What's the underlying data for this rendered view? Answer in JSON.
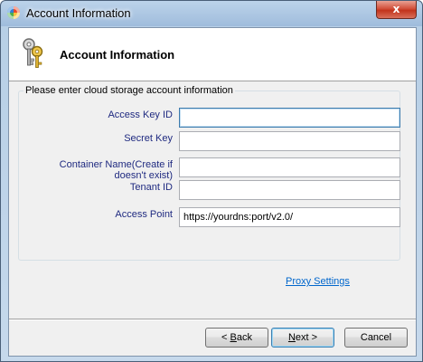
{
  "window": {
    "title": "Account Information",
    "close_glyph": "x"
  },
  "header": {
    "title": "Account Information",
    "icon": "keys-icon"
  },
  "form": {
    "group_label": "Please enter cloud storage account information",
    "fields": {
      "access_key_id": {
        "label": "Access Key ID",
        "value": ""
      },
      "secret_key": {
        "label": "Secret Key",
        "value": ""
      },
      "container_name": {
        "label_line1": "Container Name(Create if",
        "label_line2": "doesn't exist)",
        "value": ""
      },
      "tenant_id": {
        "label": "Tenant ID",
        "value": ""
      },
      "access_point": {
        "label": "Access Point",
        "value": "https://yourdns:port/v2.0/"
      }
    },
    "proxy_link": "Proxy Settings"
  },
  "buttons": {
    "back": {
      "prefix": "< ",
      "mnemonic": "B",
      "rest": "ack"
    },
    "next": {
      "mnemonic": "N",
      "rest": "ext >"
    },
    "cancel": "Cancel"
  },
  "colors": {
    "label_text": "#1f2a80",
    "link": "#0066cc",
    "focus_border": "#3d7bad"
  }
}
